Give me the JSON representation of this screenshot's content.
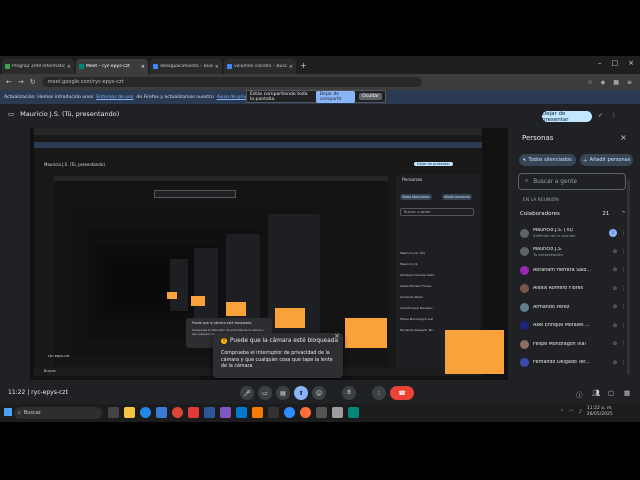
{
  "browser": {
    "tabs": [
      {
        "label": "Progra2 2/99 Informática · Clas",
        "color": "#34a853"
      },
      {
        "label": "Meet – ryc-epys-czt",
        "color": "#00897b"
      },
      {
        "label": "desaguacimiento – Buscar con",
        "color": "#4285f4"
      },
      {
        "label": "volumen cilindro – Buscar con",
        "color": "#4285f4"
      }
    ],
    "url": "meet.google.com/ryc-epys-czt",
    "notification": {
      "prefix": "Actualización: Hemos introducido unos",
      "link1": "Entornos de uso",
      "middle": "de Firefox y actualizamos nuestro",
      "link2": "Aviso de privacidad",
      "suffix": "Tómese un momento"
    },
    "sharing": {
      "text": "Estás compartiendo toda la pantalla.",
      "stop": "Dejar de compartir",
      "hide": "Ocultar"
    }
  },
  "meet": {
    "presenter": "Mauricio J.S. (Tú, presentando)",
    "stop_presenting": "Dejar de presentar",
    "code": "ryc-epys-czt",
    "time": "11:22",
    "separator": "|"
  },
  "people": {
    "title": "Personas",
    "mute_all": "Todos silenciados",
    "add": "Añadir personas",
    "search_placeholder": "Buscar a gente",
    "section": "EN LA REUNIÓN",
    "group": "Colaboradores",
    "count": "21",
    "list": [
      {
        "name": "Mauricio J.S. (Tú)",
        "sub": "Anfitrión de la reunión",
        "color": "#5f6368"
      },
      {
        "name": "Mauricio J.S.",
        "sub": "Tu presentación",
        "color": "#5f6368"
      },
      {
        "name": "Abraham Herrera Sald...",
        "sub": "",
        "color": "#9c27b0"
      },
      {
        "name": "Alexis Romero Flores",
        "sub": "",
        "color": "#795548"
      },
      {
        "name": "Armando Perez",
        "sub": "",
        "color": "#607d8b"
      },
      {
        "name": "Axel Enrique Morales ...",
        "sub": "",
        "color": "#1a237e"
      },
      {
        "name": "Felipe Mondragón Ival",
        "sub": "",
        "color": "#8d6e63"
      },
      {
        "name": "Fernando Delgado Ter...",
        "sub": "",
        "color": "#3949ab"
      }
    ]
  },
  "popup": {
    "title": "Puede que la cámara esté bloqueada",
    "body": "Comprueba el interruptor de privacidad de la cámara y que cualquier cosa que tape la lente de la cámara"
  },
  "taskbar": {
    "search": "Buscar",
    "time": "11:22 a. m.",
    "date": "26/05/2025"
  },
  "nested": {
    "presenter": "Mauricio J.S. (Tú, presentando)",
    "people_title": "Personas",
    "mute_all": "Todos silenciados",
    "add": "Añadir personas",
    "search": "Buscar a gente",
    "popup_title": "Puede que la cámara esté bloqueada",
    "popup_body": "Comprueba el interruptor de privacidad de la cámara y que cualquier cosa que tape la lente de la cámara",
    "names": [
      "Mauricio J.S. (Tú)",
      "Mauricio J.S.",
      "Abraham Herrera Sald...",
      "Alexis Romero Flores",
      "Armando Perez",
      "Axel Enrique Morales...",
      "Felipe Mondragón Ival",
      "Fernando Delgado Ter..."
    ],
    "search_label": "Buscar",
    "code": "ryc-epys-czt",
    "stop_presenting": "Dejar de presentar"
  }
}
